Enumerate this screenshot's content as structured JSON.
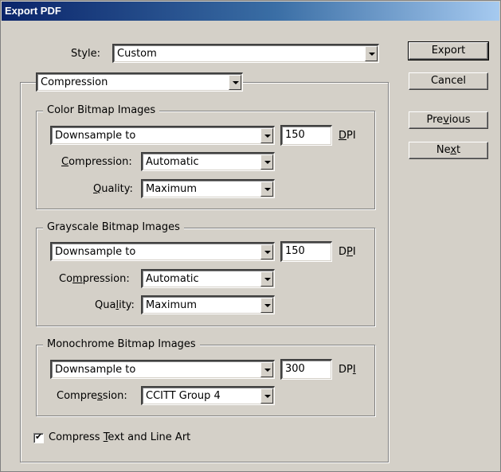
{
  "window": {
    "title": "Export PDF"
  },
  "style": {
    "label": "Style:",
    "value": "Custom"
  },
  "section": {
    "value": "Compression"
  },
  "color": {
    "title": "Color Bitmap Images",
    "sampling": "Downsample to",
    "dpi": "150",
    "dpi_unit": "DPI",
    "compression_label": "Compression:",
    "compression": "Automatic",
    "quality_label": "Quality:",
    "quality": "Maximum"
  },
  "gray": {
    "title": "Grayscale Bitmap Images",
    "sampling": "Downsample to",
    "dpi": "150",
    "dpi_unit": "DPI",
    "compression_label": "Compression:",
    "compression": "Automatic",
    "quality_label": "Quality:",
    "quality": "Maximum"
  },
  "mono": {
    "title": "Monochrome Bitmap Images",
    "sampling": "Downsample to",
    "dpi": "300",
    "dpi_unit": "DPI",
    "compression_label": "Compression:",
    "compression": "CCITT Group 4"
  },
  "compress_text": {
    "checked": true,
    "label": "Compress Text and Line Art"
  },
  "buttons": {
    "export": "Export",
    "cancel": "Cancel",
    "previous": "Previous",
    "next": "Next"
  }
}
